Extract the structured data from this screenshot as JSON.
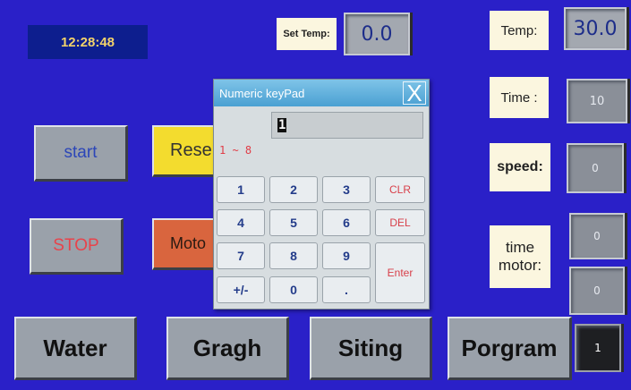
{
  "clock": "12:28:48",
  "set_temp": {
    "label": "Set Temp:",
    "value": "0.0"
  },
  "temp": {
    "label": "Temp:",
    "value": "30.0"
  },
  "time": {
    "label": "Time :",
    "value": "10"
  },
  "speed": {
    "label": "speed:",
    "value": "0"
  },
  "time_motor": {
    "label": "time\nmotor:",
    "value1": "0",
    "value2": "0"
  },
  "buttons": {
    "start": "start",
    "reset": "Rese",
    "stop": "STOP",
    "motor": "Moto"
  },
  "bottom_tabs": [
    "Water",
    "Gragh",
    "Siting",
    "Porgram"
  ],
  "program_number": "1",
  "keypad": {
    "title": "Numeric keyPad",
    "close": "X",
    "display": "1",
    "range": "1 ~ 8",
    "keys": [
      "1",
      "2",
      "3",
      "CLR",
      "4",
      "5",
      "6",
      "DEL",
      "7",
      "8",
      "9",
      "Enter",
      "+/-",
      "0",
      "."
    ]
  },
  "colors": {
    "background": "#2a20c8",
    "reset_button": "#f3dc2e",
    "motor_button": "#d9653e",
    "stop_text": "#e8434b",
    "start_text": "#2c46b8"
  }
}
